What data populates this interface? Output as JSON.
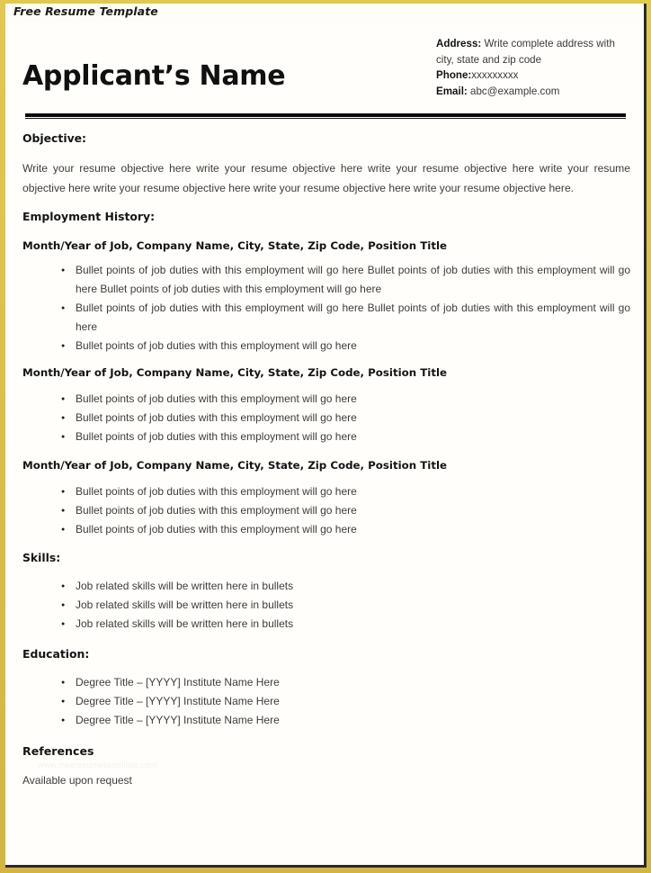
{
  "document": {
    "template_label": "Free Resume Template",
    "frame_color": "#d9ba45",
    "sheet_color": "#fffefb"
  },
  "header": {
    "applicant_name": "Applicant’s Name",
    "contact": {
      "address_label": "Address:",
      "address_value": "Write complete address with city, state and zip code",
      "phone_label": "Phone:",
      "phone_value": "xxxxxxxxx",
      "email_label": "Email:",
      "email_value": "abc@example.com"
    }
  },
  "sections": {
    "objective": {
      "heading": "Objective:",
      "body": "Write your resume objective here write your resume objective here write your resume objective here write your resume objective here write your resume objective here write your resume objective here write your resume objective here."
    },
    "employment": {
      "heading": "Employment History:",
      "jobs": [
        {
          "title_line": "Month/Year of Job, Company Name, City, State, Zip Code, Position Title",
          "bullets": [
            "Bullet points of job duties with this employment will go here Bullet points of job duties with this employment will go here Bullet points of job duties with this employment will go here",
            "Bullet points of job duties with this employment will go here Bullet points of job duties with this employment will go here",
            "Bullet points of job duties with this employment will go here"
          ]
        },
        {
          "title_line": "Month/Year of Job, Company Name, City, State, Zip Code, Position Title",
          "bullets": [
            "Bullet points of job duties with this employment will go here",
            "Bullet points of job duties with this employment will go here",
            "Bullet points of job duties with this employment will go here"
          ]
        },
        {
          "title_line": "Month/Year of Job, Company Name, City, State, Zip Code, Position Title",
          "bullets": [
            "Bullet points of job duties with this employment will go here",
            "Bullet points of job duties with this employment will go here",
            "Bullet points of job duties with this employment will go here"
          ]
        }
      ]
    },
    "skills": {
      "heading": "Skills:",
      "bullets": [
        "Job related skills will be written here in bullets",
        "Job related skills will be written here in bullets",
        "Job related skills will be written here in bullets"
      ]
    },
    "education": {
      "heading": "Education:",
      "bullets": [
        "Degree Title – [YYYY] Institute Name Here",
        "Degree Title – [YYYY] Institute Name Here",
        "Degree Title – [YYYY] Institute Name Here"
      ]
    },
    "references": {
      "heading": "References",
      "watermark": "www.freeresumetemplate.com",
      "body": "Available upon request"
    }
  }
}
